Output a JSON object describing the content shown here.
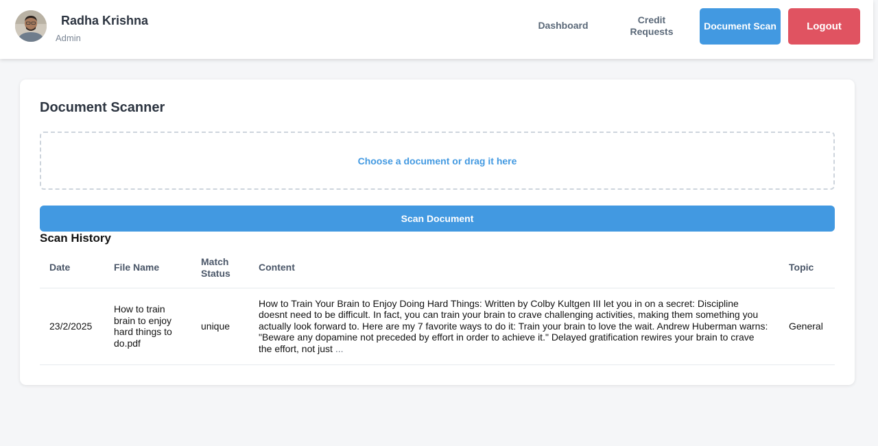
{
  "colors": {
    "primary": "#4299e1",
    "danger": "#e05361",
    "page_background": "#f5f6f8"
  },
  "user": {
    "name": "Radha Krishna",
    "role": "Admin",
    "avatar_icon": "user-photo-avatar"
  },
  "nav": {
    "dashboard": "Dashboard",
    "credit_requests": "Credit Requests",
    "document_scan": "Document Scan",
    "logout": "Logout"
  },
  "scanner": {
    "title": "Document Scanner",
    "dropzone_label": "Choose a document or drag it here",
    "scan_button": "Scan Document"
  },
  "history": {
    "title": "Scan History",
    "columns": [
      "Date",
      "File Name",
      "Match Status",
      "Content",
      "Topic"
    ],
    "rows": [
      {
        "date": "23/2/2025",
        "file_name": "How to train brain to enjoy hard things to do.pdf",
        "match_status": "unique",
        "content": "How to Train Your Brain to Enjoy Doing Hard Things: Written by Colby Kultgen III let you in on a secret: Discipline doesnt need to be difficult. In fact, you can train your brain to crave challenging activities, making them something you actually look forward to. Here are my 7 favorite ways to do it: Train your brain to love the wait. Andrew Huberman warns: \"Beware any dopamine not preceded by effort in order to achieve it.\" Delayed gratification rewires your brain to crave the effort, not just",
        "content_ellipsis": "...",
        "topic": "General"
      }
    ]
  }
}
